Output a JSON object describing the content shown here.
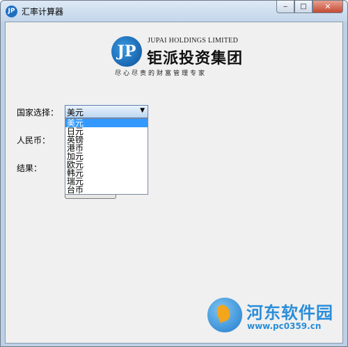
{
  "window": {
    "title": "汇率计算器",
    "min_label": "‒",
    "max_label": "□",
    "close_label": "✕"
  },
  "logo": {
    "mark": "JP",
    "english": "JUPAI HOLDINGS LIMITED",
    "chinese": "钜派投资集团",
    "slogan": "尽心尽责的财富管理专家"
  },
  "form": {
    "country_label": "国家选择：",
    "rmb_label": "人民币：",
    "result_label": "结果：",
    "selected": "美元",
    "options": [
      "美元",
      "日元",
      "英镑",
      "港币",
      "加元",
      "欧元",
      "韩元",
      "瑞元",
      "台币"
    ]
  },
  "watermark": {
    "title": "河东软件园",
    "url": "www.pc0359.cn"
  },
  "colors": {
    "selection": "#3399ff",
    "watermark": "#2a8dd8"
  }
}
